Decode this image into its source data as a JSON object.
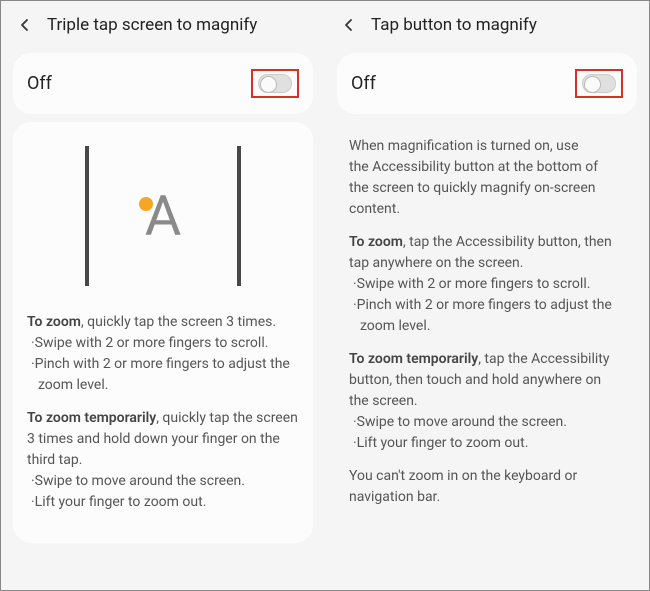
{
  "left": {
    "title": "Triple tap screen to magnify",
    "toggle_label": "Off",
    "zoom_bold": "To zoom",
    "zoom_rest": ", quickly tap the screen 3 times.",
    "zoom_b1": "·Swipe with 2 or more fingers to scroll.",
    "zoom_b2": "·Pinch with 2 or more fingers to adjust the",
    "zoom_b2b": "  zoom level.",
    "temp_bold": "To zoom temporarily",
    "temp_rest": ", quickly tap the screen",
    "temp_l2": "3 times and hold down your finger on the",
    "temp_l3": "third tap.",
    "temp_b1": "·Swipe to move around the screen.",
    "temp_b2": "·Lift your finger to zoom out."
  },
  "right": {
    "title": "Tap button to magnify",
    "toggle_label": "Off",
    "intro_l1": "When magnification is turned on, use",
    "intro_l2": "the Accessibility button at the bottom of",
    "intro_l3": "the screen to quickly magnify on-screen",
    "intro_l4": "content.",
    "zoom_bold": "To zoom",
    "zoom_rest": ", tap the Accessibility button, then",
    "zoom_l2": "tap anywhere on the screen.",
    "zoom_b1": "·Swipe with 2 or more fingers to scroll.",
    "zoom_b2": "·Pinch with 2 or more fingers to adjust the",
    "zoom_b2b": "  zoom level.",
    "temp_bold": "To zoom temporarily",
    "temp_rest": ", tap the Accessibility",
    "temp_l2": "button, then touch and hold anywhere on",
    "temp_l3": "the screen.",
    "temp_b1": "·Swipe to move around the screen.",
    "temp_b2": "·Lift your finger to zoom out.",
    "note_l1": "You can't zoom in on the keyboard or",
    "note_l2": "navigation bar."
  }
}
